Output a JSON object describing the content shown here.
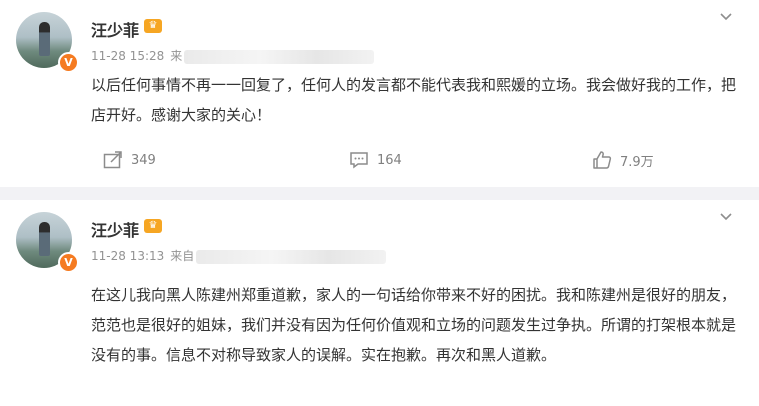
{
  "posts": [
    {
      "username": "汪少菲",
      "time": "11-28 15:28",
      "source_prefix": "来",
      "text": "以后任何事情不再一一回复了，任何人的发言都不能代表我和熙媛的立场。我会做好我的工作，把店开好。感谢大家的关心！",
      "repost_count": "349",
      "comment_count": "164",
      "like_count": "7.9万"
    },
    {
      "username": "汪少菲",
      "time": "11-28 13:13",
      "source_prefix": "来自",
      "text": "在这儿我向黑人陈建州郑重道歉，家人的一句话给你带来不好的困扰。我和陈建州是很好的朋友，范范也是很好的姐妹，我们并没有因为任何价值观和立场的问题发生过争执。所谓的打架根本就是没有的事。信息不对称导致家人的误解。实在抱歉。再次和黑人道歉。"
    }
  ],
  "icons": {
    "verified": "verified-v-icon",
    "vip": "vip-crown-icon",
    "menu": "chevron-down-icon",
    "repost": "repost-icon",
    "comment": "comment-icon",
    "like": "thumbs-up-icon"
  },
  "colors": {
    "verified_badge": "#f57b21",
    "vip_badge": "#f6a623",
    "separator": "#f2f2f5"
  }
}
